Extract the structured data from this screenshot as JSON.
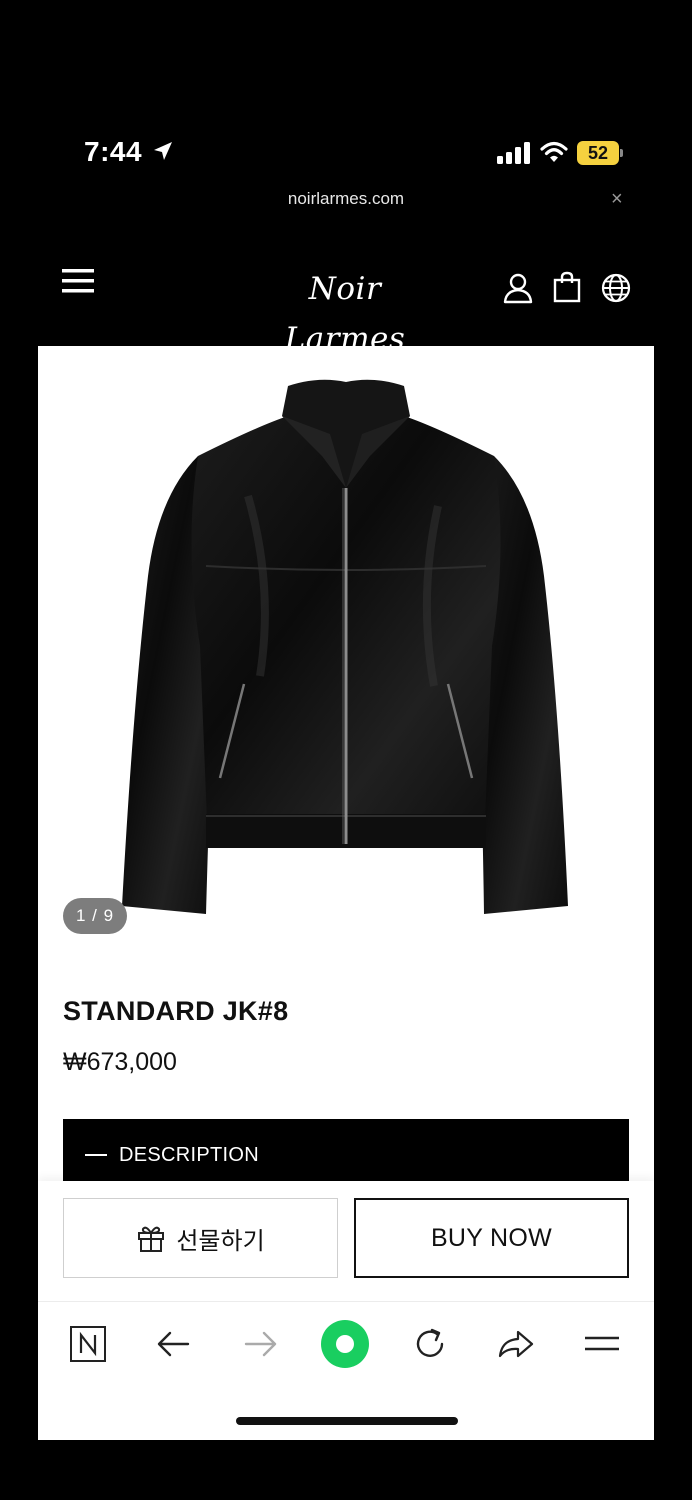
{
  "status_bar": {
    "time": "7:44",
    "battery_percent": "52",
    "battery_color": "#f5d13f"
  },
  "browser": {
    "url": "noirlarmes.com",
    "close_label": "×"
  },
  "site_header": {
    "logo": "Noir Larmes",
    "icons": [
      "menu-icon",
      "user-icon",
      "shopping-bag-icon",
      "globe-icon"
    ]
  },
  "product": {
    "slide_counter": "1 / 9",
    "title": "STANDARD JK#8",
    "price": "₩673,000",
    "description_label": "DESCRIPTION"
  },
  "actions": {
    "gift_label": "선물하기",
    "buy_label": "BUY NOW"
  },
  "toolbar": {
    "icons": [
      "naver-n-icon",
      "back-arrow-icon",
      "forward-arrow-icon",
      "green-home-icon",
      "refresh-icon",
      "share-icon",
      "menu-lines-icon"
    ],
    "accent_color": "#19ce60"
  }
}
